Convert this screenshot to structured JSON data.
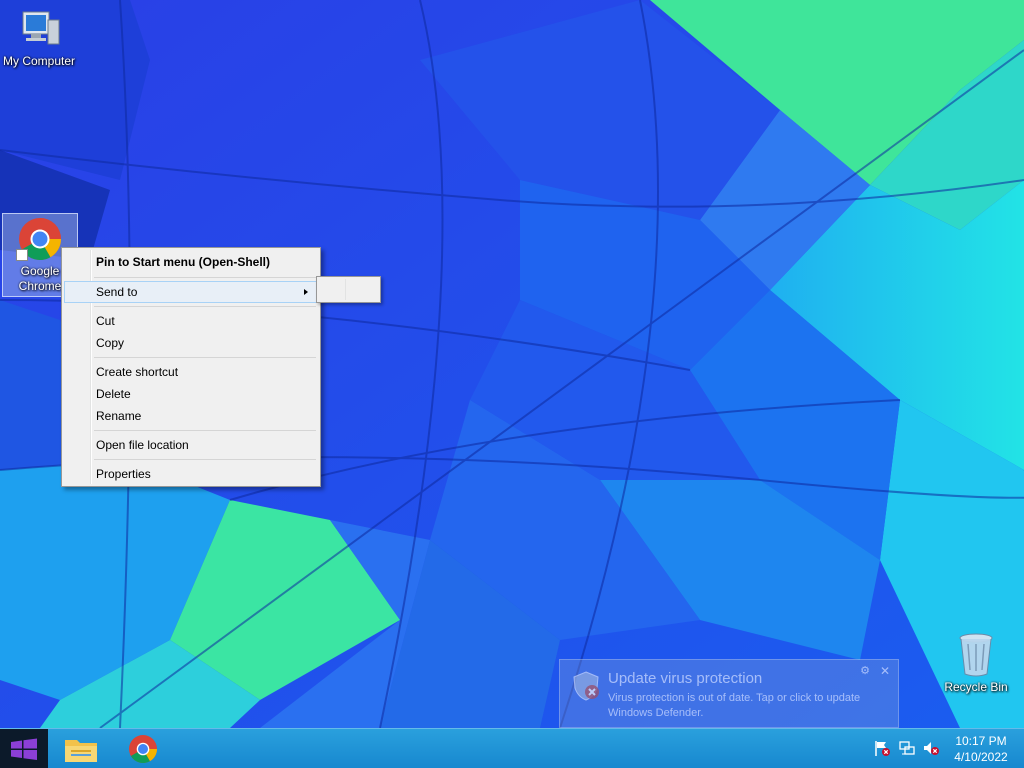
{
  "desktop": {
    "icons": [
      {
        "label": "My Computer",
        "icon": "computer-icon"
      },
      {
        "label": "Google Chrome",
        "icon": "chrome-icon"
      },
      {
        "label": "Recycle Bin",
        "icon": "recycle-bin-icon"
      }
    ]
  },
  "context_menu": {
    "pin": "Pin to Start menu (Open-Shell)",
    "send_to": "Send to",
    "cut": "Cut",
    "copy": "Copy",
    "create_shortcut": "Create shortcut",
    "delete": "Delete",
    "rename": "Rename",
    "open_file_location": "Open file location",
    "properties": "Properties"
  },
  "notification": {
    "title": "Update virus protection",
    "body": "Virus protection is out of date. Tap or click to update Windows Defender.",
    "icon": "shield-warning-icon"
  },
  "taskbar": {
    "start_icon": "windows-logo-icon",
    "pinned": [
      "file-explorer-icon",
      "chrome-icon"
    ],
    "tray": [
      "action-center-flag-icon",
      "network-icon",
      "volume-muted-icon"
    ],
    "time": "10:17 PM",
    "date": "4/10/2022"
  },
  "colors": {
    "taskbar": "#1788cf",
    "menu_background": "#f0f0f0",
    "menu_hover": "#e8eff7",
    "menu_hover_border": "#a8d2f6"
  }
}
